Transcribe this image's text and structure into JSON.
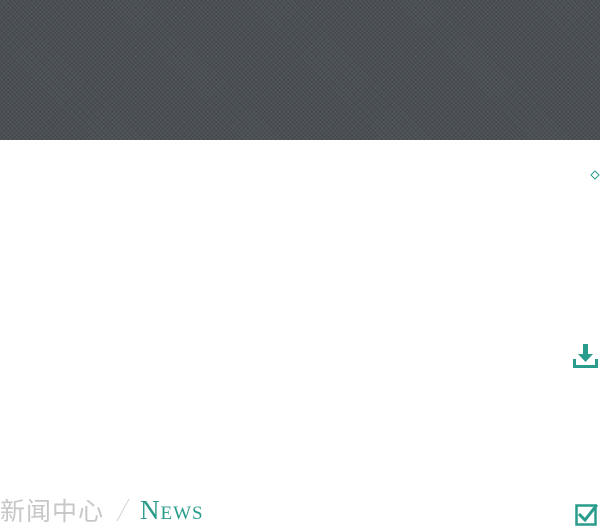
{
  "banner": {
    "background": "#4b5055"
  },
  "icons": {
    "diamond": "diamond-outline-icon",
    "download": "download-tray-icon",
    "checkbox": "checked-box-icon"
  },
  "section": {
    "title_zh": "新闻中心",
    "title_en": "News"
  },
  "colors": {
    "accent": "#2a9c8c",
    "muted_text": "#c7c7c7"
  }
}
